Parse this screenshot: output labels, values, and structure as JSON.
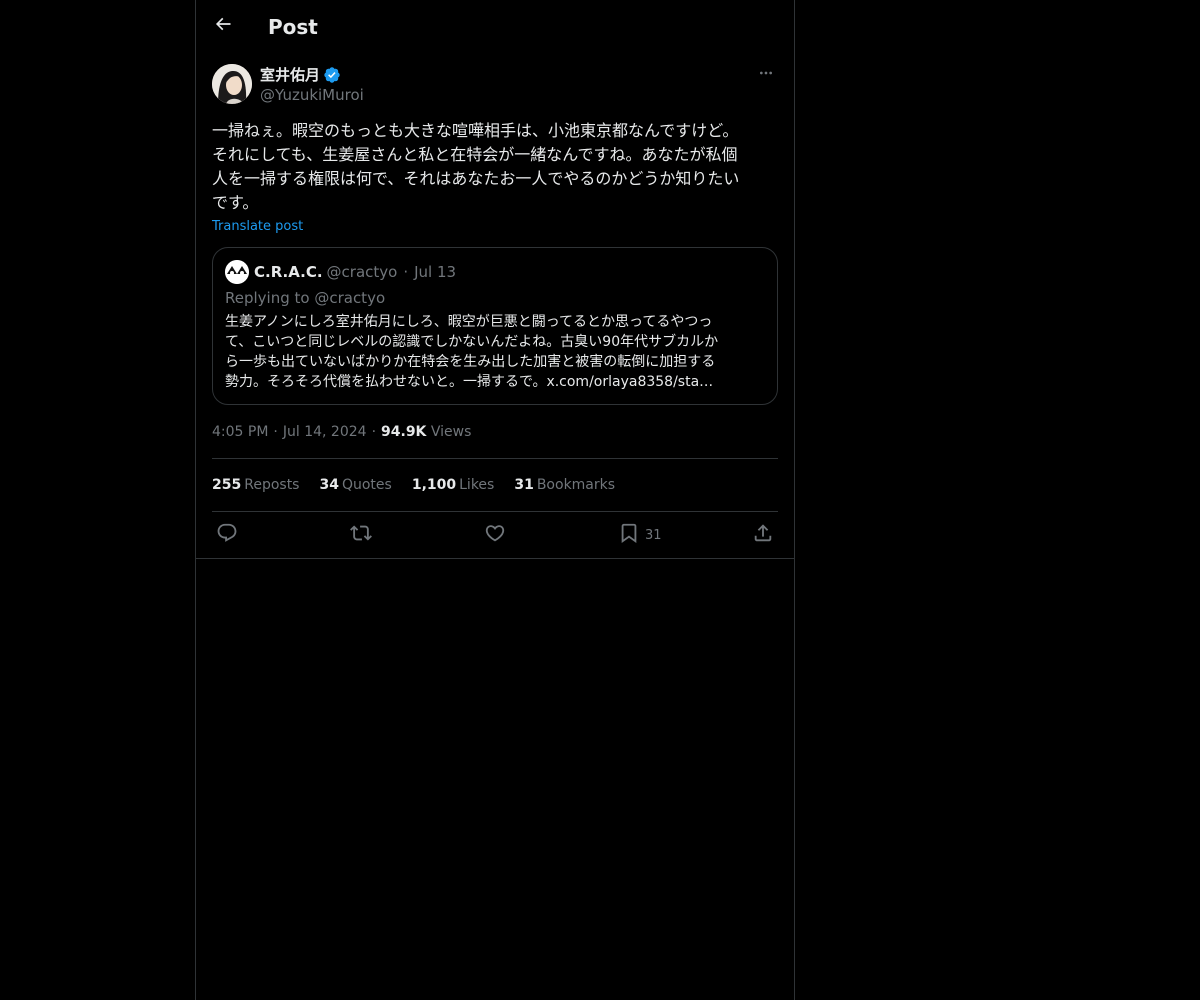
{
  "header": {
    "title": "Post",
    "back_icon": "arrow-left-icon"
  },
  "post": {
    "author_name": "室井佑月",
    "author_verified": true,
    "author_handle": "@YuzukiMuroi",
    "text": "一掃ねぇ。暇空のもっとも大きな喧嘩相手は、小池東京都なんですけど。\nそれにしても、生姜屋さんと私と在特会が一緒なんですね。あなたが私個\n人を一掃する権限は何で、それはあなたお一人でやるのかどうか知りたい\nです。",
    "translate_label": "Translate post",
    "time": "4:05 PM",
    "date": "Jul 14, 2024",
    "views_count": "94.9K",
    "views_label": "Views"
  },
  "quote": {
    "author_name": "C.R.A.C.",
    "author_handle": "@cractyo",
    "date": "Jul 13",
    "replying_to": "Replying to @cractyo",
    "text": "生姜アノンにしろ室井佑月にしろ、暇空が巨悪と闘ってるとか思ってるやつっ\nて、こいつと同じレベルの認識でしかないんだよね。古臭い90年代サブカルか\nら一歩も出ていないばかりか在特会を生み出した加害と被害の転倒に加担する\n勢力。そろそろ代償を払わせないと。一掃するで。x.com/orlaya8358/sta…"
  },
  "stats": [
    {
      "count": "255",
      "label": "Reposts"
    },
    {
      "count": "34",
      "label": "Quotes"
    },
    {
      "count": "1,100",
      "label": "Likes"
    },
    {
      "count": "31",
      "label": "Bookmarks"
    }
  ],
  "actions": {
    "reply_icon": "reply-icon",
    "repost_icon": "repost-icon",
    "like_icon": "heart-icon",
    "bookmark_icon": "bookmark-icon",
    "bookmark_count": "31",
    "share_icon": "share-icon"
  },
  "colors": {
    "background": "#000000",
    "text": "#e7e9ea",
    "secondary": "#71767b",
    "accent": "#1d9bf0",
    "border": "#2f3336"
  }
}
